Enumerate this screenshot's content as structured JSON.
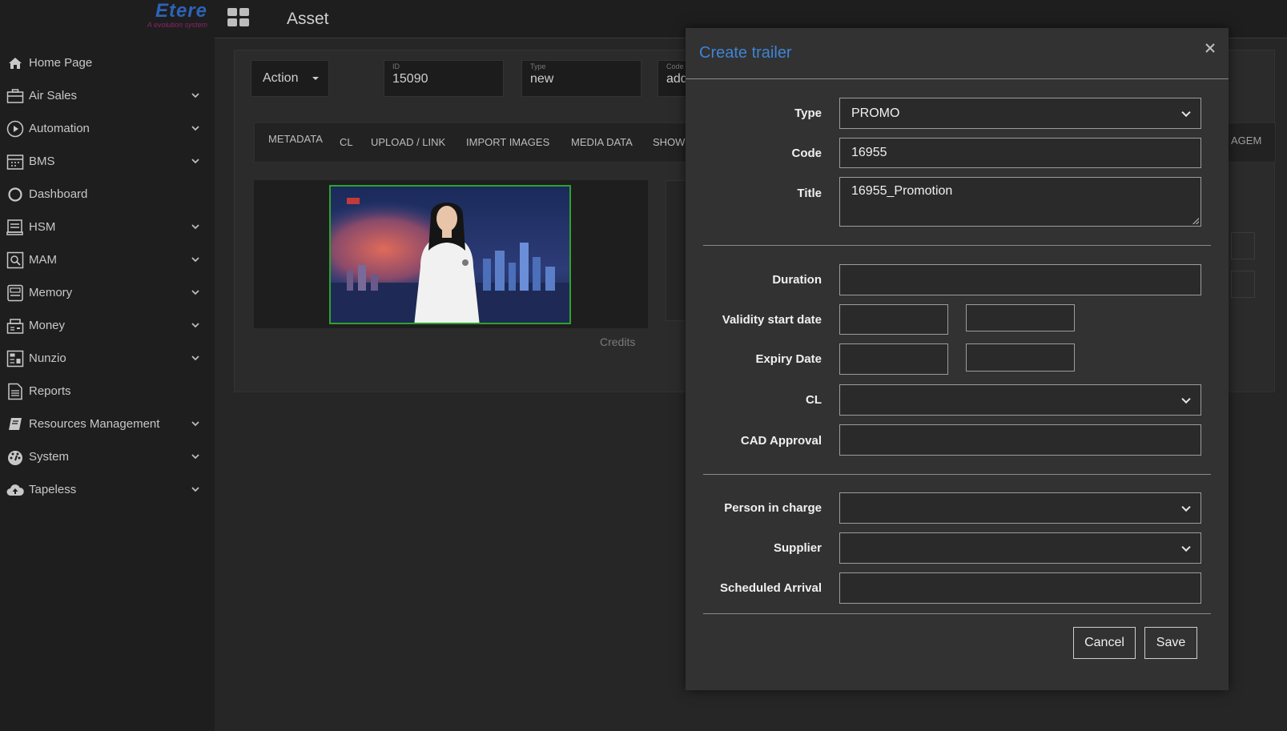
{
  "brand": {
    "name": "Etere",
    "tagline": "A evolution system"
  },
  "sidebar": {
    "items": [
      {
        "label": "Home Page",
        "icon": "home-icon",
        "expandable": false
      },
      {
        "label": "Air Sales",
        "icon": "briefcase-icon",
        "expandable": true
      },
      {
        "label": "Automation",
        "icon": "play-circle-icon",
        "expandable": true
      },
      {
        "label": "BMS",
        "icon": "calendar-icon",
        "expandable": true
      },
      {
        "label": "Dashboard",
        "icon": "circle-icon",
        "expandable": false
      },
      {
        "label": "HSM",
        "icon": "storage-icon",
        "expandable": true
      },
      {
        "label": "MAM",
        "icon": "search-media-icon",
        "expandable": true
      },
      {
        "label": "Memory",
        "icon": "memory-icon",
        "expandable": true
      },
      {
        "label": "Money",
        "icon": "register-icon",
        "expandable": true
      },
      {
        "label": "Nunzio",
        "icon": "panel-icon",
        "expandable": true
      },
      {
        "label": "Reports",
        "icon": "report-icon",
        "expandable": false
      },
      {
        "label": "Resources Management",
        "icon": "book-icon",
        "expandable": true
      },
      {
        "label": "System",
        "icon": "dashboard-gauge-icon",
        "expandable": true
      },
      {
        "label": "Tapeless",
        "icon": "cloud-upload-icon",
        "expandable": true
      }
    ]
  },
  "header": {
    "title": "Asset",
    "menu_icon": "grid-icon"
  },
  "asset": {
    "action_label": "Action",
    "id_label": "ID",
    "id_value": "15090",
    "type_label": "Type",
    "type_value": "new",
    "code_label": "Code",
    "code_value": "add"
  },
  "tabs": [
    "METADATA",
    "CL",
    "UPLOAD / LINK",
    "IMPORT IMAGES",
    "MEDIA DATA",
    "SHOW"
  ],
  "right_partial_tab": "AGEM",
  "credits_label": "Credits",
  "dialog": {
    "title": "Create trailer",
    "fields": {
      "type": {
        "label": "Type",
        "value": "PROMO"
      },
      "code": {
        "label": "Code",
        "value": "16955"
      },
      "title": {
        "label": "Title",
        "value": "16955_Promotion"
      },
      "duration": {
        "label": "Duration",
        "value": ""
      },
      "validity_start": {
        "label": "Validity start date",
        "date": "",
        "time": ""
      },
      "expiry": {
        "label": "Expiry Date",
        "date": "",
        "time": ""
      },
      "cl": {
        "label": "CL",
        "value": ""
      },
      "cad_approval": {
        "label": "CAD Approval",
        "value": ""
      },
      "person_in_charge": {
        "label": "Person in charge",
        "value": ""
      },
      "supplier": {
        "label": "Supplier",
        "value": ""
      },
      "scheduled_arrival": {
        "label": "Scheduled Arrival",
        "value": ""
      }
    },
    "cancel_label": "Cancel",
    "save_label": "Save"
  },
  "colors": {
    "background": "#262626",
    "sidebar": "#1e1e1e",
    "dialog": "#323232",
    "dialog_title": "#3f84d4",
    "thumbnail_border": "#2ea22e"
  }
}
